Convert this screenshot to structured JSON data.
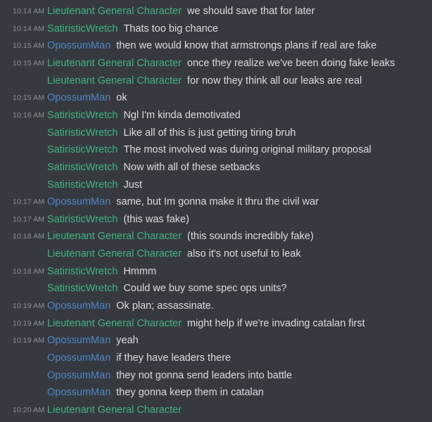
{
  "colors": {
    "background": "#36393f",
    "timestamp": "#8e9297",
    "message_text": "#dcddde",
    "lieutenant": "#43b581",
    "satiristic": "#43b581",
    "opossum": "#4f87c5"
  },
  "messages": [
    {
      "time": "10:14 AM",
      "author": "Lieutenant General Character",
      "color": "#43b581",
      "text": "we should save that for later"
    },
    {
      "time": "10:14 AM",
      "author": "SatiristicWretch",
      "color": "#43b581",
      "text": "Thats too big chance"
    },
    {
      "time": "10:15 AM",
      "author": "OpossumMan",
      "color": "#4f87c5",
      "text": "then we would know that armstrongs plans if real are fake"
    },
    {
      "time": "10:15 AM",
      "author": "Lieutenant General Character",
      "color": "#43b581",
      "text": "once they realize we've been doing fake leaks"
    },
    {
      "time": "",
      "author": "Lieutenant General Character",
      "color": "#43b581",
      "text": "for now they think all our leaks are real"
    },
    {
      "time": "10:15 AM",
      "author": "OpossumMan",
      "color": "#4f87c5",
      "text": "ok"
    },
    {
      "time": "10:16 AM",
      "author": "SatiristicWretch",
      "color": "#43b581",
      "text": "Ngl I'm kinda demotivated"
    },
    {
      "time": "",
      "author": "SatiristicWretch",
      "color": "#43b581",
      "text": "Like all of this is just getting tiring bruh"
    },
    {
      "time": "",
      "author": "SatiristicWretch",
      "color": "#43b581",
      "text": "The most involved was during original military proposal"
    },
    {
      "time": "",
      "author": "SatiristicWretch",
      "color": "#43b581",
      "text": "Now with all of these setbacks"
    },
    {
      "time": "",
      "author": "SatiristicWretch",
      "color": "#43b581",
      "text": "Just"
    },
    {
      "time": "10:17 AM",
      "author": "OpossumMan",
      "color": "#4f87c5",
      "text": "same, but Im gonna make it thru the civil war"
    },
    {
      "time": "10:17 AM",
      "author": "SatiristicWretch",
      "color": "#43b581",
      "text": "(this was fake)"
    },
    {
      "time": "10:18 AM",
      "author": "Lieutenant General Character",
      "color": "#43b581",
      "text": "(this sounds incredibly fake)"
    },
    {
      "time": "",
      "author": "Lieutenant General Character",
      "color": "#43b581",
      "text": "also it's not useful to leak"
    },
    {
      "time": "10:18 AM",
      "author": "SatiristicWretch",
      "color": "#43b581",
      "text": "Hmmm"
    },
    {
      "time": "",
      "author": "SatiristicWretch",
      "color": "#43b581",
      "text": "Could we buy some spec ops units?"
    },
    {
      "time": "10:19 AM",
      "author": "OpossumMan",
      "color": "#4f87c5",
      "text": "Ok plan; assassinate."
    },
    {
      "time": "10:19 AM",
      "author": "Lieutenant General Character",
      "color": "#43b581",
      "text": "might help if we're invading catalan first"
    },
    {
      "time": "10:19 AM",
      "author": "OpossumMan",
      "color": "#4f87c5",
      "text": "yeah"
    },
    {
      "time": "",
      "author": "OpossumMan",
      "color": "#4f87c5",
      "text": "if they have leaders there"
    },
    {
      "time": "",
      "author": "OpossumMan",
      "color": "#4f87c5",
      "text": "they not gonna send leaders into battle"
    },
    {
      "time": "",
      "author": "OpossumMan",
      "color": "#4f87c5",
      "text": "they gonna keep them in catalan"
    },
    {
      "time": "10:20 AM",
      "author": "Lieutenant General Character",
      "color": "#43b581",
      "text": ""
    }
  ]
}
